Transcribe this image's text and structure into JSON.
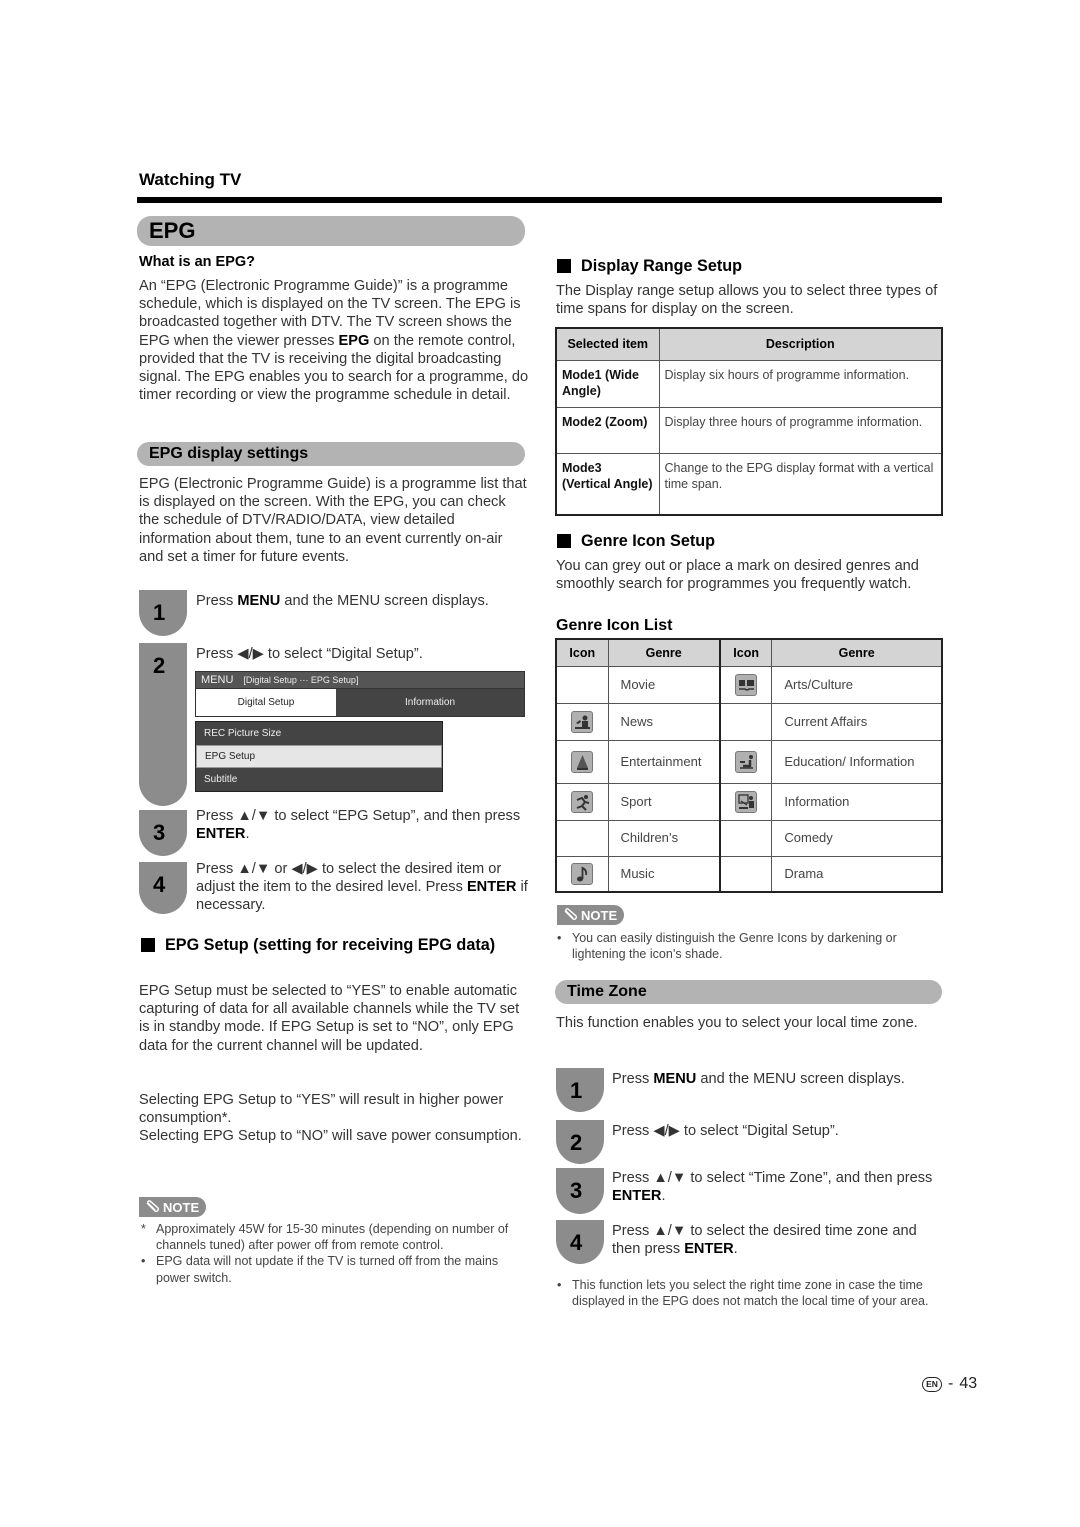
{
  "header": {
    "section": "Watching TV"
  },
  "epg": {
    "title": "EPG",
    "what_heading": "What is an EPG?",
    "what_body": "An “EPG (Electronic Programme Guide)” is a programme schedule, which is displayed on the TV screen. The EPG is broadcasted together with DTV. The TV screen shows the EPG when the viewer presses EPG on the remote control, provided that the TV is receiving the digital broadcasting signal. The EPG enables you to search for a programme, do timer recording or view the programme schedule in detail.",
    "what_body_parts": [
      "An “EPG (Electronic Programme Guide)” is a programme schedule, which is displayed on the TV screen. The EPG is broadcasted together with DTV. The TV screen shows the EPG when the viewer presses ",
      "EPG",
      " on the remote control, provided that the TV is receiving the digital broadcasting signal. The EPG enables you to search for a programme, do timer recording or view the programme schedule in detail."
    ]
  },
  "display_settings": {
    "title": "EPG display settings",
    "body": "EPG (Electronic Programme Guide) is a programme list that is displayed on the screen. With the EPG, you can check the schedule of DTV/RADIO/DATA, view detailed information about them, tune to an event currently on-air and set a timer for future events.",
    "steps": [
      {
        "num": "1",
        "pre": "Press ",
        "key": "MENU",
        "post": " and the MENU screen displays."
      },
      {
        "num": "2",
        "pre": "Press ◀/▶ to select “Digital Setup”.",
        "key": "",
        "post": ""
      },
      {
        "num": "3",
        "pre": "Press ▲/▼ to select “EPG Setup”, and then press ",
        "key": "ENTER",
        "post": "."
      },
      {
        "num": "4",
        "pre": "Press ▲/▼ or ◀/▶ to select the desired item or adjust the item to the desired level. Press ",
        "key": "ENTER",
        "post": " if necessary."
      }
    ],
    "menu": {
      "bar_label": "MENU",
      "crumb": "[Digital Setup ··· EPG Setup]",
      "tabs": [
        "Digital Setup",
        "Information"
      ],
      "items": [
        "REC Picture Size",
        "EPG Setup",
        "Subtitle"
      ],
      "selected_item": "EPG Setup"
    }
  },
  "epg_setup": {
    "title": "EPG Setup (setting for receiving EPG data)",
    "body1": "EPG Setup must be selected to “YES” to enable automatic capturing of data for all available channels while the TV set is in standby mode.  If EPG Setup is set to “NO”, only EPG data for the current channel will be updated.",
    "body2": "Selecting EPG Setup to “YES” will result in higher power consumption*.",
    "body3": "Selecting EPG Setup to “NO” will save power consumption.",
    "note_label": "NOTE",
    "notes": [
      {
        "mark": "*",
        "text": "Approximately 45W for 15-30 minutes (depending on number of channels tuned) after power off from remote control."
      },
      {
        "mark": "•",
        "text": "EPG data will not update if the TV is turned off from the mains power switch."
      }
    ]
  },
  "display_range": {
    "title": "Display Range Setup",
    "body": "The Display range setup allows you to select three types of time spans for display on the screen.",
    "headers": [
      "Selected item",
      "Description"
    ],
    "rows": [
      {
        "item": "Mode1 (Wide Angle)",
        "desc": "Display six hours of programme information."
      },
      {
        "item": "Mode2 (Zoom)",
        "desc": "Display three hours of programme information."
      },
      {
        "item": "Mode3 (Vertical Angle)",
        "desc": "Change to the EPG display format with a vertical time span."
      }
    ]
  },
  "genre_setup": {
    "title": "Genre Icon Setup",
    "body": "You can grey out or place a mark on desired genres and smoothly search for programmes you frequently watch.",
    "list_title": "Genre Icon List",
    "headers": [
      "Icon",
      "Genre",
      "Icon",
      "Genre"
    ],
    "rows": [
      {
        "left": {
          "icon": "",
          "genre": "Movie"
        },
        "right": {
          "icon": "arts-culture-icon",
          "genre": "Arts/Culture"
        }
      },
      {
        "left": {
          "icon": "news-icon",
          "genre": "News"
        },
        "right": {
          "icon": "",
          "genre": "Current Affairs"
        }
      },
      {
        "left": {
          "icon": "entertainment-icon",
          "genre": "Entertainment"
        },
        "right": {
          "icon": "education-icon",
          "genre": "Education/ Information"
        }
      },
      {
        "left": {
          "icon": "sport-icon",
          "genre": "Sport"
        },
        "right": {
          "icon": "information-icon",
          "genre": "Information"
        }
      },
      {
        "left": {
          "icon": "",
          "genre": "Children’s"
        },
        "right": {
          "icon": "",
          "genre": "Comedy"
        }
      },
      {
        "left": {
          "icon": "music-icon",
          "genre": "Music"
        },
        "right": {
          "icon": "",
          "genre": "Drama"
        }
      }
    ],
    "note_label": "NOTE",
    "notes": [
      {
        "mark": "•",
        "text": "You can easily distinguish the Genre Icons by darkening or lightening the icon’s shade."
      }
    ]
  },
  "time_zone": {
    "title": "Time Zone",
    "body": "This function enables you to select your local time zone.",
    "steps": [
      {
        "num": "1",
        "pre": "Press ",
        "key": "MENU",
        "post": " and the MENU screen displays."
      },
      {
        "num": "2",
        "pre": "Press ◀/▶ to select “Digital Setup”.",
        "key": "",
        "post": ""
      },
      {
        "num": "3",
        "pre": "Press ▲/▼ to select “Time Zone”, and then press ",
        "key": "ENTER",
        "post": "."
      },
      {
        "num": "4",
        "pre": "Press ▲/▼ to select the desired time zone and then press ",
        "key": "ENTER",
        "post": "."
      }
    ],
    "notes": [
      {
        "mark": "•",
        "text": "This function lets you select the right time zone in case the time displayed in the EPG does not match the local time of your area."
      }
    ]
  },
  "footer": {
    "lang": "EN",
    "sep": "-",
    "page": "43"
  }
}
